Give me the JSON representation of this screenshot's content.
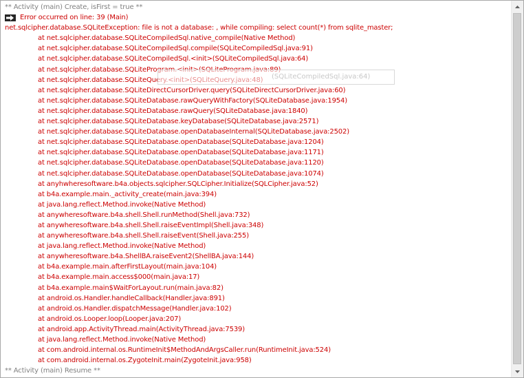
{
  "log": {
    "header": "** Activity (main) Create, isFirst = true **",
    "error_line": "Error occurred on line: 39 (Main)",
    "exception": "net.sqlcipher.database.SQLiteException: file is not a database: , while compiling: select count(*) from sqlite_master;",
    "stack_trace": [
      "at net.sqlcipher.database.SQLiteCompiledSql.native_compile(Native Method)",
      "at net.sqlcipher.database.SQLiteCompiledSql.compile(SQLiteCompiledSql.java:91)",
      "at net.sqlcipher.database.SQLiteCompiledSql.<init>(SQLiteCompiledSql.java:64)",
      "at net.sqlcipher.database.SQLiteProgram.<init>(SQLiteProgram.java:89)",
      "at net.sqlcipher.database.SQLiteQuery.<init>(SQLiteQuery.java:48)",
      "at net.sqlcipher.database.SQLiteDirectCursorDriver.query(SQLiteDirectCursorDriver.java:60)",
      "at net.sqlcipher.database.SQLiteDatabase.rawQueryWithFactory(SQLiteDatabase.java:1954)",
      "at net.sqlcipher.database.SQLiteDatabase.rawQuery(SQLiteDatabase.java:1840)",
      "at net.sqlcipher.database.SQLiteDatabase.keyDatabase(SQLiteDatabase.java:2571)",
      "at net.sqlcipher.database.SQLiteDatabase.openDatabaseInternal(SQLiteDatabase.java:2502)",
      "at net.sqlcipher.database.SQLiteDatabase.openDatabase(SQLiteDatabase.java:1204)",
      "at net.sqlcipher.database.SQLiteDatabase.openDatabase(SQLiteDatabase.java:1171)",
      "at net.sqlcipher.database.SQLiteDatabase.openDatabase(SQLiteDatabase.java:1120)",
      "at net.sqlcipher.database.SQLiteDatabase.openDatabase(SQLiteDatabase.java:1074)",
      "at anyhwheresoftware.b4a.objects.sqlcipher.SQLCipher.Initialize(SQLCipher.java:52)",
      "at b4a.example.main._activity_create(main.java:394)",
      "at java.lang.reflect.Method.invoke(Native Method)",
      "at anywheresoftware.b4a.shell.Shell.runMethod(Shell.java:732)",
      "at anywheresoftware.b4a.shell.Shell.raiseEventImpl(Shell.java:348)",
      "at anywheresoftware.b4a.shell.Shell.raiseEvent(Shell.java:255)",
      "at java.lang.reflect.Method.invoke(Native Method)",
      "at anywheresoftware.b4a.ShellBA.raiseEvent2(ShellBA.java:144)",
      "at b4a.example.main.afterFirstLayout(main.java:104)",
      "at b4a.example.main.access$000(main.java:17)",
      "at b4a.example.main$WaitForLayout.run(main.java:82)",
      "at android.os.Handler.handleCallback(Handler.java:891)",
      "at android.os.Handler.dispatchMessage(Handler.java:102)",
      "at android.os.Looper.loop(Looper.java:207)",
      "at android.app.ActivityThread.main(ActivityThread.java:7539)",
      "at java.lang.reflect.Method.invoke(Native Method)",
      "at com.android.internal.os.RuntimeInit$MethodAndArgsCaller.run(RuntimeInit.java:524)",
      "at com.android.internal.os.ZygoteInit.main(ZygoteInit.java:958)"
    ],
    "footer": "** Activity (main) Resume **",
    "tooltip": "(SQLiteCompiledSql.java:64)"
  },
  "colors": {
    "info_text": "#808080",
    "error_text": "#cc0000",
    "background": "#ffffff"
  },
  "icons": {
    "error_marker": "arrow-right-icon",
    "scroll_up": "scroll-up-arrow-icon",
    "scroll_down": "scroll-down-arrow-icon"
  }
}
